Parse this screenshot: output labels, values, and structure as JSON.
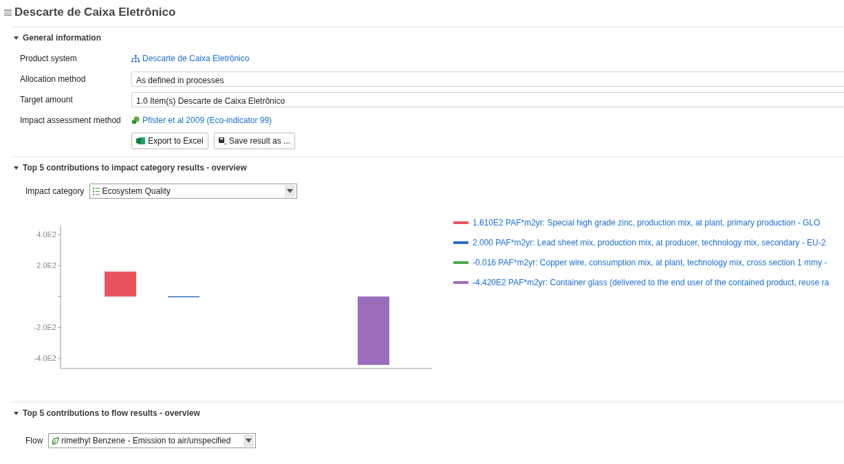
{
  "title": "Descarte de Caixa Eletrônico",
  "general": {
    "heading": "General information",
    "expanded": true,
    "product_system": {
      "label": "Product system",
      "value": "Descarte de Caixa Eletrônico"
    },
    "allocation_method": {
      "label": "Allocation method",
      "value": "As defined in processes"
    },
    "target_amount": {
      "label": "Target amount",
      "value": "1.0 Item(s) Descarte de Caixa Eletrônico"
    },
    "impact_method": {
      "label": "Impact assessment method",
      "value": "Pfister et al 2009 (Eco-indicator 99)"
    },
    "buttons": [
      "Export to Excel",
      "Save result as ..."
    ]
  },
  "impact_section": {
    "heading": "Top 5 contributions to impact category results - overview",
    "expanded": true,
    "impact_category": {
      "label": "Impact category",
      "value": "Ecosystem Quality"
    },
    "chart_data": {
      "type": "bar",
      "ylim": [
        -465,
        455
      ],
      "yticks": [
        {
          "value": 400,
          "label": "4.0E2"
        },
        {
          "value": 200,
          "label": "2.0E2"
        },
        {
          "value": -200,
          "label": "-2.0E2"
        },
        {
          "value": -400,
          "label": "-4.0E2"
        }
      ],
      "series": [
        {
          "name": "1.610E2 PAF*m2yr: Special high grade zinc, production mix, at plant, primary production - GLO",
          "color": "#e8545c",
          "values": [
            161,
            null,
            null,
            null,
            null
          ]
        },
        {
          "name": "2.000 PAF*m2yr: Lead sheet mix, production mix, at producer, technology mix, secondary - EU-2",
          "color": "#2e6fc4",
          "values": [
            null,
            2,
            null,
            null,
            null
          ]
        },
        {
          "name": "-0.016 PAF*m2yr: Copper wire, consumption mix, at plant, technology mix, cross section 1 mmy -",
          "color": "#4ea64a",
          "values": [
            null,
            null,
            0,
            null,
            null
          ]
        },
        {
          "name": "-4.420E2 PAF*m2yr: Container glass (delivered to the end user of the contained product, reuse ra",
          "color": "#9b6dbd",
          "values": [
            null,
            null,
            null,
            null,
            -442
          ]
        }
      ]
    }
  },
  "flow_section": {
    "heading": "Top 5 contributions to flow results - overview",
    "expanded": true,
    "flow": {
      "label": "Flow",
      "value": "rimethyl Benzene - Emission to air/unspecified"
    }
  }
}
